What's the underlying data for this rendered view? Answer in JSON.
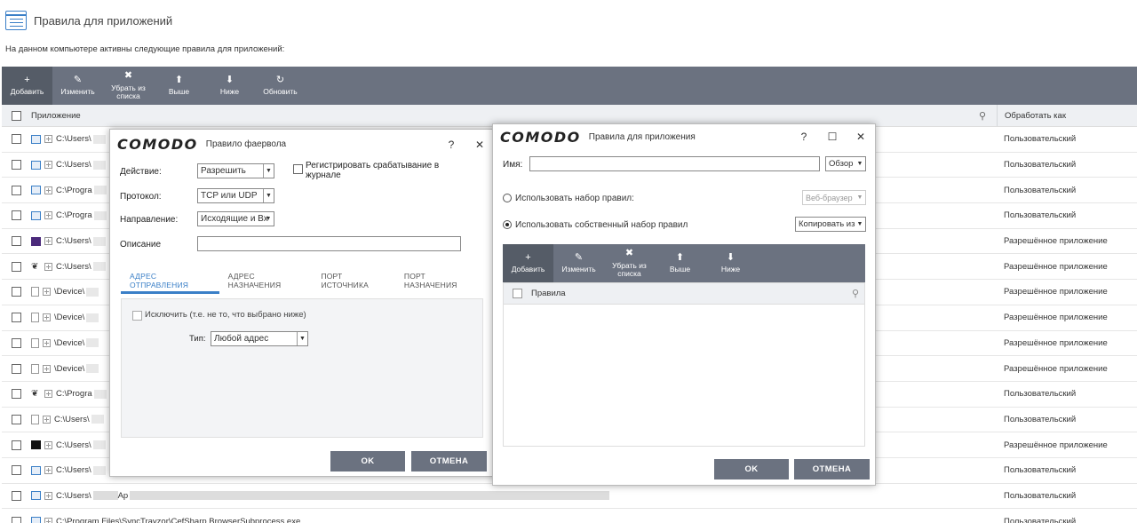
{
  "header": {
    "title": "Правила для приложений",
    "intro": "На данном компьютере активны следующие правила для приложений:"
  },
  "toolbar": [
    {
      "label": "Добавить",
      "icon": "+",
      "name": "add"
    },
    {
      "label": "Изменить",
      "icon": "✎",
      "name": "edit"
    },
    {
      "label": "Убрать из списка",
      "icon": "✖",
      "name": "remove"
    },
    {
      "label": "Выше",
      "icon": "⬆",
      "name": "up"
    },
    {
      "label": "Ниже",
      "icon": "⬇",
      "name": "down"
    },
    {
      "label": "Обновить",
      "icon": "↻",
      "name": "refresh"
    }
  ],
  "table": {
    "col_app": "Приложение",
    "col_treat": "Обработать как",
    "rows": [
      {
        "icon": "win",
        "path": "C:\\Users\\",
        "treat": "Пользовательский"
      },
      {
        "icon": "win",
        "path": "C:\\Users\\",
        "treat": "Пользовательский"
      },
      {
        "icon": "win",
        "path": "C:\\Progra",
        "treat": "Пользовательский"
      },
      {
        "icon": "win",
        "path": "C:\\Progra",
        "treat": "Пользовательский"
      },
      {
        "icon": "purple",
        "path": "C:\\Users\\",
        "treat": "Разрешённое приложение"
      },
      {
        "icon": "fox",
        "path": "C:\\Users\\",
        "treat": "Разрешённое приложение"
      },
      {
        "icon": "doc",
        "path": "\\Device\\",
        "treat": "Разрешённое приложение"
      },
      {
        "icon": "doc",
        "path": "\\Device\\",
        "treat": "Разрешённое приложение"
      },
      {
        "icon": "doc",
        "path": "\\Device\\",
        "treat": "Разрешённое приложение"
      },
      {
        "icon": "doc",
        "path": "\\Device\\",
        "treat": "Разрешённое приложение"
      },
      {
        "icon": "fox",
        "path": "C:\\Progra",
        "treat": "Пользовательский"
      },
      {
        "icon": "doc",
        "path": "C:\\Users\\",
        "treat": "Пользовательский"
      },
      {
        "icon": "black",
        "path": "C:\\Users\\",
        "treat": "Разрешённое приложение"
      },
      {
        "icon": "win",
        "path": "C:\\Users\\",
        "treat": "Пользовательский"
      },
      {
        "icon": "win",
        "path": "C:\\Users\\",
        "suffix": "Ap",
        "treat": "Пользовательский"
      },
      {
        "icon": "win",
        "path": "C:\\Program Files\\SyncTrayzor\\CefSharp.BrowserSubprocess.exe",
        "treat": "Пользовательский"
      }
    ]
  },
  "firewall_dialog": {
    "logo": "COMODO",
    "title": "Правило фаервола",
    "help": "?",
    "close": "✕",
    "action_label": "Действие:",
    "action_value": "Разрешить",
    "log_label": "Регистрировать срабатывание в журнале",
    "protocol_label": "Протокол:",
    "protocol_value": "TCP или UDP",
    "direction_label": "Направление:",
    "direction_value": "Исходящие и Вх",
    "description_label": "Описание",
    "tabs": [
      "АДРЕС ОТПРАВЛЕНИЯ",
      "АДРЕС НАЗНАЧЕНИЯ",
      "ПОРТ ИСТОЧНИКА",
      "ПОРТ НАЗНАЧЕНИЯ"
    ],
    "exclude_label": "Исключить (т.е. не то, что выбрано ниже)",
    "type_label": "Тип:",
    "type_value": "Любой адрес",
    "ok": "OK",
    "cancel": "ОТМЕНА"
  },
  "app_rules_dialog": {
    "logo": "COMODO",
    "title": "Правила для приложения",
    "help": "?",
    "maximize": "☐",
    "close": "✕",
    "name_label": "Имя:",
    "browse": "Обзор",
    "ruleset_label": "Использовать набор правил:",
    "ruleset_value": "Веб-браузер",
    "custom_label": "Использовать собственный набор правил",
    "copy_from": "Копировать из",
    "toolbar": [
      {
        "label": "Добавить",
        "icon": "+"
      },
      {
        "label": "Изменить",
        "icon": "✎"
      },
      {
        "label": "Убрать из списка",
        "icon": "✖"
      },
      {
        "label": "Выше",
        "icon": "⬆"
      },
      {
        "label": "Ниже",
        "icon": "⬇"
      }
    ],
    "rules_col": "Правила",
    "ok": "OK",
    "cancel": "ОТМЕНА"
  }
}
